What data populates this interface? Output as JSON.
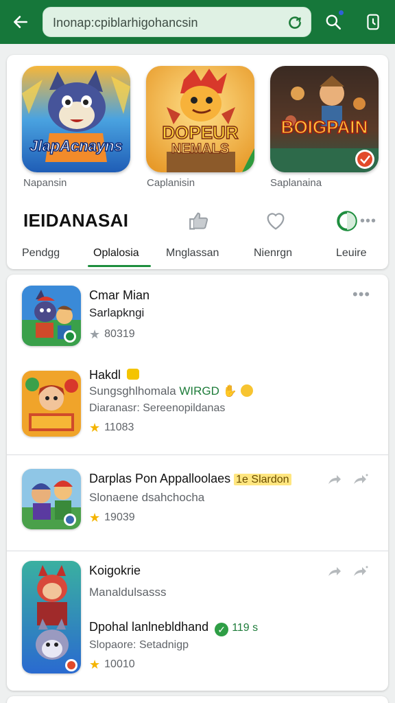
{
  "search": {
    "value": "Inonap:cpiblarhigohancsin"
  },
  "featured": [
    {
      "caption": "Napansin",
      "art_text": "JlapAcnayns"
    },
    {
      "caption": "Caplanisin",
      "art_text_1": "DOPEUR",
      "art_text_2": "NEMALS"
    },
    {
      "caption": "Saplanaina",
      "art_text": "BOIGPAIN"
    }
  ],
  "brand": {
    "title": "IEIDANASAI"
  },
  "tabs": [
    {
      "label": "Pendgg"
    },
    {
      "label": "Oplalosia"
    },
    {
      "label": "Mnglassan"
    },
    {
      "label": "Nienrgn"
    },
    {
      "label": "Leuire"
    }
  ],
  "active_tab": "Oplalosia",
  "list": {
    "item1": {
      "title": "Cmar Mian",
      "subtitle": "Sarlapkngi",
      "rating": "80319"
    },
    "item2": {
      "title": "Hakdl",
      "subtitle_a": "Sungsghlhomala",
      "subtitle_green": "WIRGD",
      "desc": "Diaranasr: Sereenopildanas",
      "rating": "11083"
    },
    "item3": {
      "title": "Darplas Pon Appalloolaes",
      "badge": "1e Slardon",
      "subtitle": "Slonaene dsahchocha",
      "rating": "19039"
    },
    "item4": {
      "title": "Koigokrie",
      "subtitle": "Manaldulsasss",
      "title2": "Dpohal lanlnebldhand",
      "badge_count": "119 s",
      "desc": "Slopaore: Setadnigp",
      "rating": "10010"
    }
  },
  "colors": {
    "appbar": "#16773a",
    "accent": "#1e8e3e",
    "star": "#f4b400",
    "highlight": "#ffe680"
  },
  "icons": [
    "back-arrow-icon",
    "refresh-icon",
    "search-icon",
    "phone-icon",
    "thumbs-up-icon",
    "heart-icon",
    "status-ring-icon",
    "more-dots-icon",
    "share-arrow-icon",
    "star-icon",
    "emoji-icon",
    "verified-check-icon"
  ]
}
